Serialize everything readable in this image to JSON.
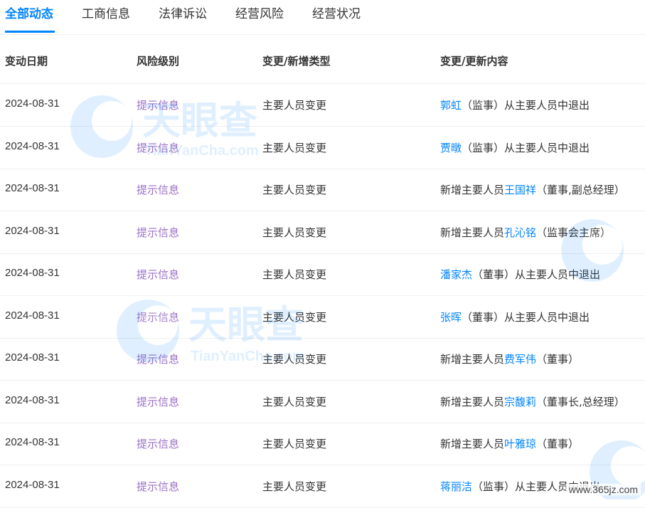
{
  "tabs": [
    {
      "label": "全部动态",
      "active": true
    },
    {
      "label": "工商信息",
      "active": false
    },
    {
      "label": "法律诉讼",
      "active": false
    },
    {
      "label": "经营风险",
      "active": false
    },
    {
      "label": "经营状况",
      "active": false
    }
  ],
  "columns": {
    "date": "变动日期",
    "risk": "风险级别",
    "type": "变更/新增类型",
    "content": "变更/更新内容"
  },
  "rows": [
    {
      "date": "2024-08-31",
      "risk": "提示信息",
      "type": "主要人员变更",
      "pre": "",
      "name": "郭虹",
      "post": "（监事）从主要人员中退出"
    },
    {
      "date": "2024-08-31",
      "risk": "提示信息",
      "type": "主要人员变更",
      "pre": "",
      "name": "贾暾",
      "post": "（监事）从主要人员中退出"
    },
    {
      "date": "2024-08-31",
      "risk": "提示信息",
      "type": "主要人员变更",
      "pre": "新增主要人员",
      "name": "王国祥",
      "post": "（董事,副总经理）"
    },
    {
      "date": "2024-08-31",
      "risk": "提示信息",
      "type": "主要人员变更",
      "pre": "新增主要人员",
      "name": "孔沁铭",
      "post": "（监事会主席）"
    },
    {
      "date": "2024-08-31",
      "risk": "提示信息",
      "type": "主要人员变更",
      "pre": "",
      "name": "潘家杰",
      "post": "（董事）从主要人员中退出"
    },
    {
      "date": "2024-08-31",
      "risk": "提示信息",
      "type": "主要人员变更",
      "pre": "",
      "name": "张晖",
      "post": "（董事）从主要人员中退出"
    },
    {
      "date": "2024-08-31",
      "risk": "提示信息",
      "type": "主要人员变更",
      "pre": "新增主要人员",
      "name": "费军伟",
      "post": "（董事）"
    },
    {
      "date": "2024-08-31",
      "risk": "提示信息",
      "type": "主要人员变更",
      "pre": "新增主要人员",
      "name": "宗馥莉",
      "post": "（董事长,总经理）"
    },
    {
      "date": "2024-08-31",
      "risk": "提示信息",
      "type": "主要人员变更",
      "pre": "新增主要人员",
      "name": "叶雅琼",
      "post": "（董事）"
    },
    {
      "date": "2024-08-31",
      "risk": "提示信息",
      "type": "主要人员变更",
      "pre": "",
      "name": "蒋丽洁",
      "post": "（监事）从主要人员中退出"
    }
  ],
  "watermark": {
    "brand": "天眼查",
    "domain": "TianYanCha.com"
  },
  "site_watermark": "www.365jz.com",
  "colors": {
    "accent": "#0084ff",
    "risk": "#9b6fc7",
    "text": "#333333",
    "divider": "#eeeeee"
  }
}
